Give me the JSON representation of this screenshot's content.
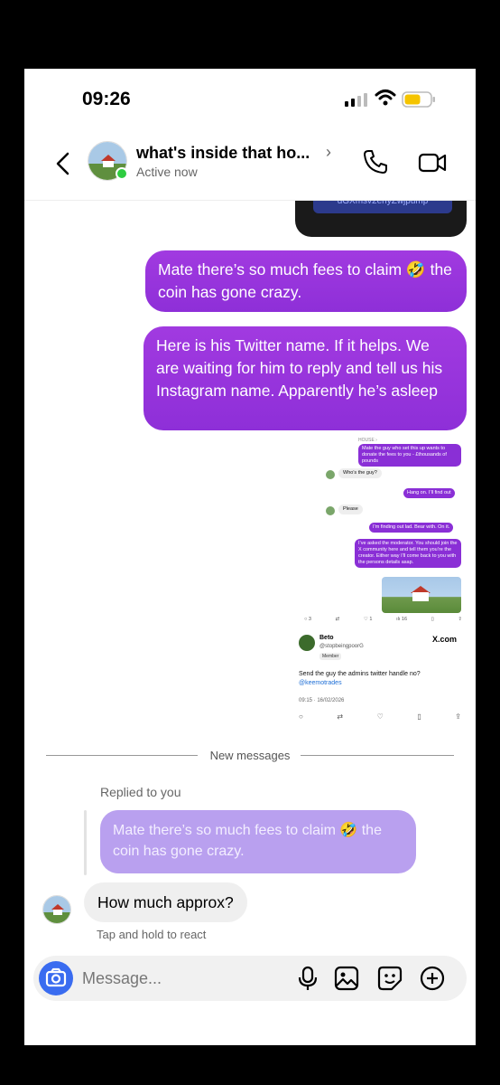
{
  "status_bar": {
    "time": "09:26"
  },
  "header": {
    "title": "what's inside that ho...",
    "title_chevron": "›",
    "subtitle": "Active now"
  },
  "preview_image": {
    "text": "dGXmsv2enyZwjpump"
  },
  "messages_sent": [
    {
      "text": "Mate there’s so much fees to claim 🤣 the coin has gone crazy."
    },
    {
      "text": "Here is his Twitter name. If it helps. We are waiting for him to reply and tell us his Instagram name. Apparently he’s asleep"
    }
  ],
  "screenshot": {
    "house_label": "HOUSE ›",
    "chat": [
      {
        "text": "Mate the guy who set this up wants to donate the fees to you - £thousands of pounds"
      },
      {
        "text": "Who’s the guy?"
      },
      {
        "text": "Hang on. I’ll find out"
      },
      {
        "text": "Please"
      },
      {
        "text": "I’m finding out lad. Bear with. On it."
      },
      {
        "text": "I’ve asked the moderator. You should join the X community here and tell them you’re the creator. Either way I’ll come back to you with the persons details asap."
      }
    ],
    "stats": {
      "comments": "3",
      "likes": "1",
      "views": "16"
    },
    "tweet": {
      "name": "Beto",
      "handle": "@stopbeingpoorG",
      "badge": "Member",
      "source": "X.com",
      "text": "Send the guy the admins twitter handle no?",
      "mention": "@keemotrades",
      "timestamp": "09:15 · 16/02/2026"
    }
  },
  "divider_label": "New messages",
  "reply": {
    "label": "Replied to you",
    "quoted": "Mate there’s so much fees to claim 🤣 the coin has gone crazy."
  },
  "received": {
    "text": "How much approx?",
    "hint": "Tap and hold to react"
  },
  "composer": {
    "placeholder": "Message..."
  },
  "colors": {
    "sent_bubble": "#9b35df",
    "reply_bubble": "#b9a0ef",
    "camera_button": "#3a6cf0",
    "online": "#2ecc40"
  },
  "icons": [
    "back-icon",
    "phone-icon",
    "video-icon",
    "camera-icon",
    "mic-icon",
    "gallery-icon",
    "sticker-icon",
    "plus-icon"
  ]
}
